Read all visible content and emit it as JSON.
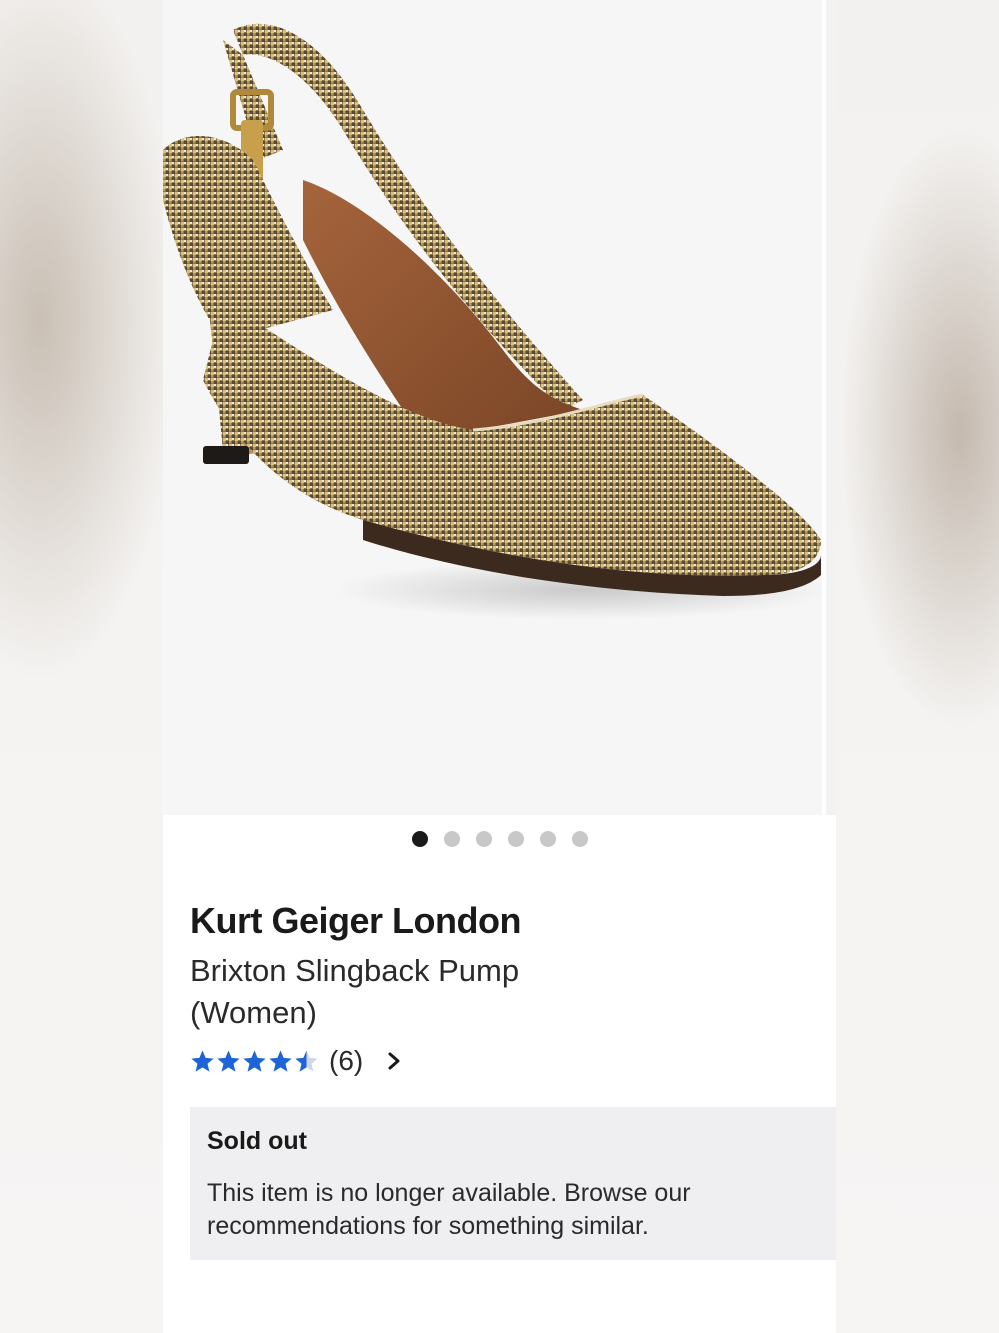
{
  "product": {
    "brand": "Kurt Geiger London",
    "name": "Brixton Slingback Pump (Women)",
    "image_alt": "Brixton Slingback Pump gold metallic slingback heel",
    "rating": 4.5,
    "rating_max": 5,
    "review_count": "(6)"
  },
  "carousel": {
    "total_images": 6,
    "active_index": 0
  },
  "availability": {
    "title": "Sold out",
    "message": "This item is no longer available. Browse our recommendations for something similar."
  },
  "colors": {
    "star": "#1f64d6",
    "star_empty": "#d0d7e2",
    "dot_active": "#1a1a1a",
    "dot_inactive": "#c8c8c8",
    "notice_bg": "#efeff1"
  },
  "icons": {
    "rating": "star-icon",
    "reviews_link": "chevron-right-icon"
  }
}
